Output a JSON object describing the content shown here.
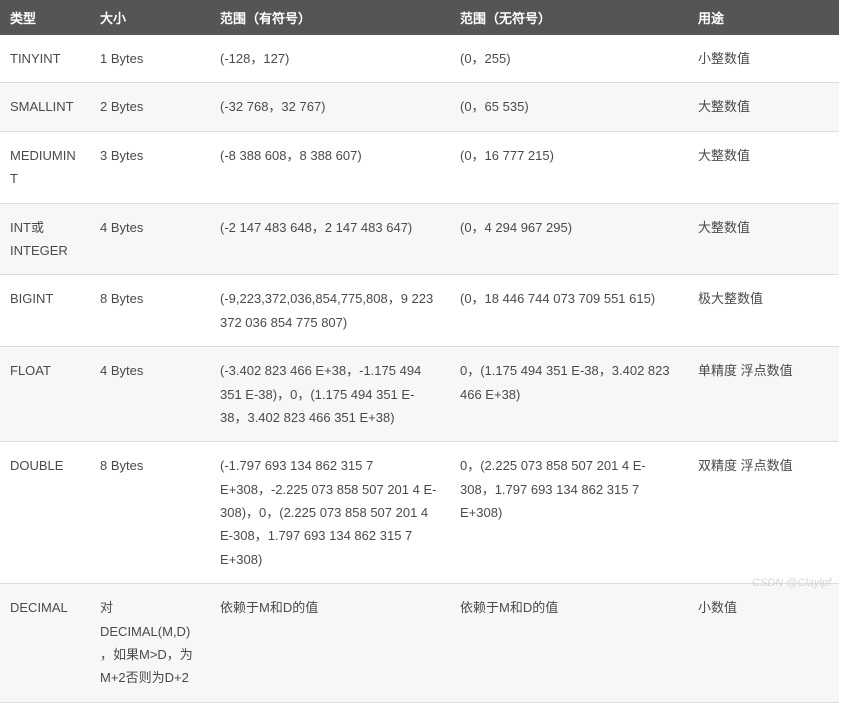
{
  "headers": {
    "type": "类型",
    "size": "大小",
    "signed": "范围（有符号）",
    "unsigned": "范围（无符号）",
    "use": "用途"
  },
  "rows": [
    {
      "type": "TINYINT",
      "size": "1 Bytes",
      "signed": "(-128，127)",
      "unsigned": "(0，255)",
      "use": "小整数值"
    },
    {
      "type": "SMALLINT",
      "size": "2 Bytes",
      "signed": "(-32 768，32 767)",
      "unsigned": "(0，65 535)",
      "use": "大整数值"
    },
    {
      "type": "MEDIUMINT",
      "size": "3 Bytes",
      "signed": "(-8 388 608，8 388 607)",
      "unsigned": "(0，16 777 215)",
      "use": "大整数值"
    },
    {
      "type": "INT或INTEGER",
      "size": "4 Bytes",
      "signed": "(-2 147 483 648，2 147 483 647)",
      "unsigned": "(0，4 294 967 295)",
      "use": "大整数值"
    },
    {
      "type": "BIGINT",
      "size": "8 Bytes",
      "signed": "(-9,223,372,036,854,775,808，9 223 372 036 854 775 807)",
      "unsigned": "(0，18 446 744 073 709 551 615)",
      "use": "极大整数值"
    },
    {
      "type": "FLOAT",
      "size": "4 Bytes",
      "signed": "(-3.402 823 466 E+38，-1.175 494 351 E-38)，0，(1.175 494 351 E-38，3.402 823 466 351 E+38)",
      "unsigned": "0，(1.175 494 351 E-38，3.402 823 466 E+38)",
      "use": "单精度 浮点数值"
    },
    {
      "type": "DOUBLE",
      "size": "8 Bytes",
      "signed": "(-1.797 693 134 862 315 7 E+308，-2.225 073 858 507 201 4 E-308)，0，(2.225 073 858 507 201 4 E-308，1.797 693 134 862 315 7 E+308)",
      "unsigned": "0，(2.225 073 858 507 201 4 E-308，1.797 693 134 862 315 7 E+308)",
      "use": "双精度 浮点数值"
    },
    {
      "type": "DECIMAL",
      "size": "对DECIMAL(M,D) ，如果M>D，为M+2否则为D+2",
      "signed": "依赖于M和D的值",
      "unsigned": "依赖于M和D的值",
      "use": "小数值"
    }
  ],
  "watermark": "CSDN @Claylpf"
}
